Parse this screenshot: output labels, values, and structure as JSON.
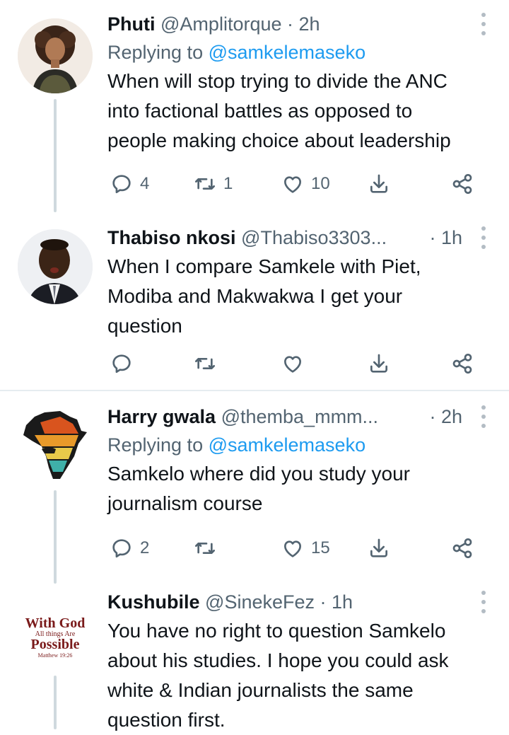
{
  "tweets": [
    {
      "name": "Phuti",
      "handle": "@Amplitorque",
      "time": "· 2h",
      "replying_prefix": "Replying to ",
      "replying_handle": "@samkelemaseko",
      "body_lines": [
        "When will stop trying to divide the ANC",
        "into factional battles as opposed to",
        "people making choice about leadership"
      ],
      "replies": "4",
      "retweets": "1",
      "likes": "10"
    },
    {
      "name": "Thabiso nkosi",
      "handle": "@Thabiso3303...",
      "time": "· 1h",
      "body_lines": [
        "When I compare Samkele with Piet,",
        "Modiba and Makwakwa I get your",
        "question"
      ],
      "replies": "",
      "retweets": "",
      "likes": ""
    },
    {
      "name": "Harry gwala",
      "handle": "@themba_mmm...",
      "time": "· 2h",
      "replying_prefix": "Replying to ",
      "replying_handle": "@samkelemaseko",
      "body_lines": [
        "Samkelo where did you study your",
        "journalism course"
      ],
      "replies": "2",
      "retweets": "",
      "likes": "15"
    },
    {
      "name": "Kushubile",
      "handle": "@SinekeFez",
      "time": "· 1h",
      "avatar_text": [
        "With God",
        "All things Are",
        "Possible",
        "Matthew 19:26"
      ],
      "body_lines": [
        "You have no right to question Samkelo",
        "about his studies. I hope you could ask",
        "white & Indian journalists the same",
        "question first."
      ]
    }
  ],
  "icons": [
    "reply-icon",
    "retweet-icon",
    "like-icon",
    "share-icon",
    "more-icon"
  ],
  "colors": {
    "link": "#1d9bf0",
    "secondary": "#536471",
    "text": "#0f1419",
    "divider": "#e6ecf0"
  }
}
